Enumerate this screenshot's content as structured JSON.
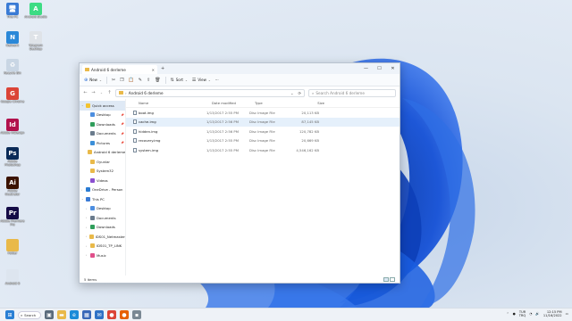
{
  "desktop_icons": [
    {
      "label": "This PC",
      "color": "#3a7bd5",
      "glyph": "🖥"
    },
    {
      "label": "Android Studio",
      "color": "#3ddc84",
      "glyph": "A"
    },
    {
      "label": "Network",
      "color": "#2a88d8",
      "glyph": "N"
    },
    {
      "label": "Telegram Desktop",
      "color": "#dfe3e8",
      "glyph": "T"
    },
    {
      "label": "Recycle Bin",
      "color": "#c9d6e4",
      "glyph": "♻"
    },
    {
      "label": "Google Chrome",
      "color": "#db4437",
      "glyph": "G"
    },
    {
      "label": "Adobe InDesign",
      "color": "#b1114c",
      "glyph": "Id"
    },
    {
      "label": "Adobe Photoshop",
      "color": "#0a2a57",
      "glyph": "Ps"
    },
    {
      "label": "Adobe Illustrator",
      "color": "#3b1300",
      "glyph": "Ai"
    },
    {
      "label": "Adobe Premiere Pro",
      "color": "#140b46",
      "glyph": "Pr"
    },
    {
      "label": "Folder",
      "color": "#e9b949",
      "glyph": ""
    },
    {
      "label": "Android 6",
      "color": "#dde5ef",
      "glyph": ""
    }
  ],
  "window": {
    "tab_title": "Android 6 derleme",
    "toolbar": {
      "new": "New",
      "sort": "Sort",
      "view": "View",
      "more": "···"
    },
    "address": "Android 6 derleme",
    "search_placeholder": "Search Android 6 derleme",
    "nav": [
      {
        "label": "Quick access",
        "icon_color": "#f3c330",
        "arrow": "⌄",
        "selected": true,
        "pin": false,
        "indent": 0
      },
      {
        "label": "Desktop",
        "icon_color": "#4c8ee0",
        "arrow": "",
        "selected": false,
        "pin": true,
        "indent": 1
      },
      {
        "label": "Downloads",
        "icon_color": "#2f9e5b",
        "arrow": "",
        "selected": false,
        "pin": true,
        "indent": 1
      },
      {
        "label": "Documents",
        "icon_color": "#6a7b8c",
        "arrow": "",
        "selected": false,
        "pin": true,
        "indent": 1
      },
      {
        "label": "Pictures",
        "icon_color": "#3b8fd8",
        "arrow": "",
        "selected": false,
        "pin": true,
        "indent": 1
      },
      {
        "label": "Android 6 derleme",
        "icon_color": "#e9b949",
        "arrow": "",
        "selected": false,
        "pin": false,
        "indent": 1
      },
      {
        "label": "Oyunlar",
        "icon_color": "#e9b949",
        "arrow": "",
        "selected": false,
        "pin": false,
        "indent": 1
      },
      {
        "label": "System32",
        "icon_color": "#e9b949",
        "arrow": "",
        "selected": false,
        "pin": false,
        "indent": 1
      },
      {
        "label": "Videos",
        "icon_color": "#8a4fd0",
        "arrow": "",
        "selected": false,
        "pin": false,
        "indent": 1
      },
      {
        "label": "OneDrive - Person",
        "icon_color": "#2b7cd3",
        "arrow": "›",
        "selected": false,
        "pin": false,
        "indent": 0
      },
      {
        "label": "This PC",
        "icon_color": "#3a7bd5",
        "arrow": "⌄",
        "selected": false,
        "pin": false,
        "indent": 0
      },
      {
        "label": "Desktop",
        "icon_color": "#4c8ee0",
        "arrow": "›",
        "selected": false,
        "pin": false,
        "indent": 1
      },
      {
        "label": "Documents",
        "icon_color": "#6a7b8c",
        "arrow": "›",
        "selected": false,
        "pin": false,
        "indent": 1
      },
      {
        "label": "Downloads",
        "icon_color": "#2f9e5b",
        "arrow": "›",
        "selected": false,
        "pin": false,
        "indent": 1
      },
      {
        "label": "IDS01_Netmaster",
        "icon_color": "#e9b949",
        "arrow": "›",
        "selected": false,
        "pin": false,
        "indent": 1
      },
      {
        "label": "IDS01_TP_LINK",
        "icon_color": "#e9b949",
        "arrow": "›",
        "selected": false,
        "pin": false,
        "indent": 1
      },
      {
        "label": "Music",
        "icon_color": "#e0508a",
        "arrow": "›",
        "selected": false,
        "pin": false,
        "indent": 1
      }
    ],
    "columns": {
      "name": "Name",
      "date": "Date modified",
      "type": "Type",
      "size": "Size"
    },
    "files": [
      {
        "name": "boot.img",
        "date": "1/13/2017 2:55 PM",
        "type": "Disc Image File",
        "size": "20,113 KB",
        "highlight": false
      },
      {
        "name": "cache.img",
        "date": "1/13/2017 2:56 PM",
        "type": "Disc Image File",
        "size": "87,145 KB",
        "highlight": true
      },
      {
        "name": "hidden.img",
        "date": "1/13/2017 2:56 PM",
        "type": "Disc Image File",
        "size": "120,782 KB",
        "highlight": false
      },
      {
        "name": "recovery.img",
        "date": "1/13/2017 2:55 PM",
        "type": "Disc Image File",
        "size": "20,669 KB",
        "highlight": false
      },
      {
        "name": "system.img",
        "date": "1/13/2017 2:55 PM",
        "type": "Disc Image File",
        "size": "4,546,162 KB",
        "highlight": false
      }
    ],
    "status": "5 items"
  },
  "taskbar": {
    "search_label": "Search",
    "apps": [
      {
        "name": "start-icon",
        "color": "#2a7fd4",
        "glyph": "⊞"
      },
      {
        "name": "task-view-icon",
        "color": "#5a6b7c",
        "glyph": "▣"
      },
      {
        "name": "explorer-icon",
        "color": "#e9b949",
        "glyph": "▬"
      },
      {
        "name": "edge-icon",
        "color": "#1c8bd8",
        "glyph": "e"
      },
      {
        "name": "store-icon",
        "color": "#3a68b8",
        "glyph": "▦"
      },
      {
        "name": "mail-icon",
        "color": "#2f72c6",
        "glyph": "✉"
      },
      {
        "name": "chrome-icon",
        "color": "#db4437",
        "glyph": "●"
      },
      {
        "name": "firefox-icon",
        "color": "#e66000",
        "glyph": "●"
      },
      {
        "name": "app-icon",
        "color": "#7a8894",
        "glyph": "▪"
      }
    ],
    "lang": "TUR",
    "lang2": "TRQ",
    "time": "12:15 PM",
    "date": "11/16/2022"
  }
}
